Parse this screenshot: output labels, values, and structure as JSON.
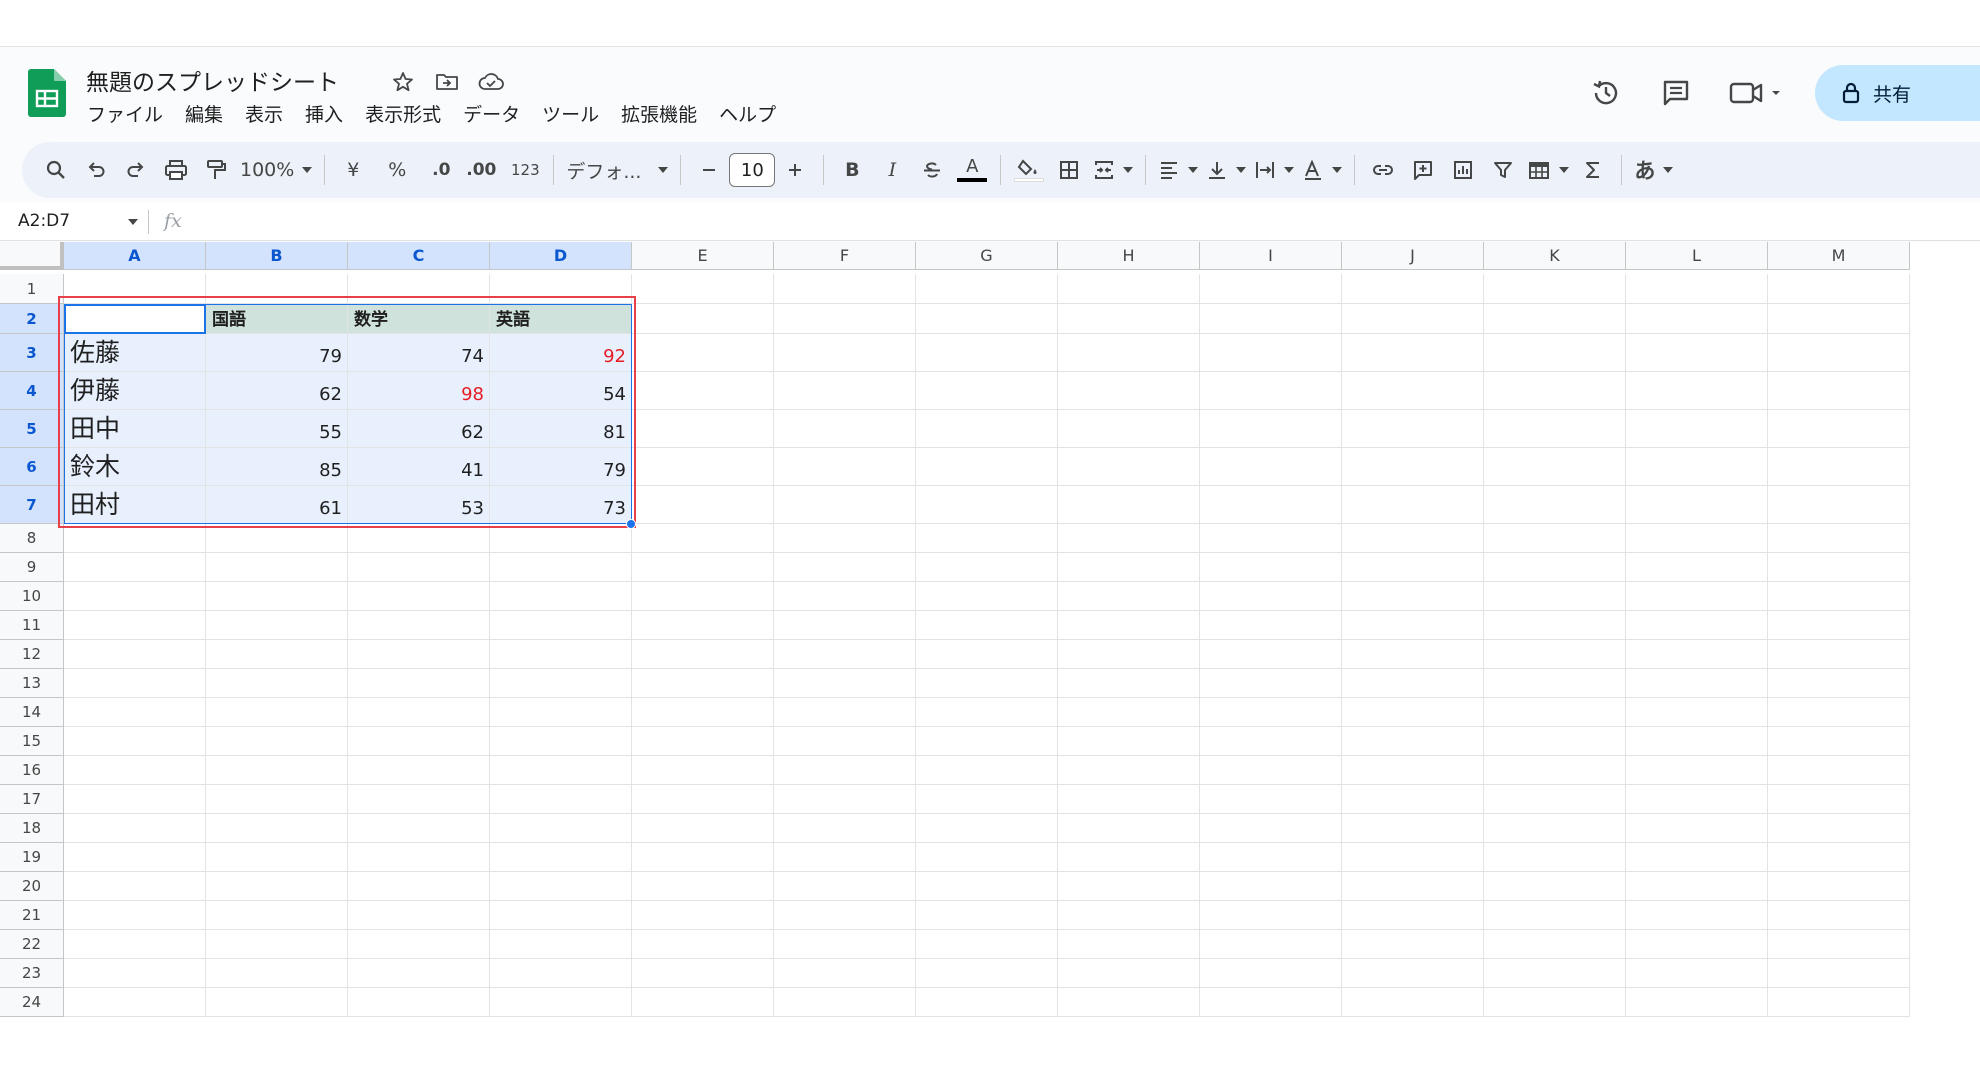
{
  "app": {
    "title": "無題のスプレッドシート",
    "menu": [
      "ファイル",
      "編集",
      "表示",
      "挿入",
      "表示形式",
      "データ",
      "ツール",
      "拡張機能",
      "ヘルプ"
    ],
    "share_label": "共有"
  },
  "toolbar": {
    "zoom": "100%",
    "currency": "¥",
    "percent": "%",
    "dec_decrease": ".0",
    "dec_increase": ".00",
    "number_format": "123",
    "font": "デフォ...",
    "font_size": "10",
    "bold": "B",
    "italic": "I",
    "text_color_glyph": "A",
    "ime_glyph": "あ"
  },
  "formula_bar": {
    "name_box": "A2:D7",
    "fx": "fx",
    "value": ""
  },
  "sheet": {
    "columns": [
      "A",
      "B",
      "C",
      "D",
      "E",
      "F",
      "G",
      "H",
      "I",
      "J",
      "K",
      "L",
      "M"
    ],
    "selected_columns": [
      "A",
      "B",
      "C",
      "D"
    ],
    "rows": [
      "1",
      "2",
      "3",
      "4",
      "5",
      "6",
      "7",
      "8",
      "9",
      "10",
      "11",
      "12",
      "13",
      "14",
      "15",
      "16",
      "17",
      "18",
      "19",
      "20",
      "21",
      "22",
      "23",
      "24"
    ],
    "selected_rows": [
      "2",
      "3",
      "4",
      "5",
      "6",
      "7"
    ],
    "header_row": [
      "",
      "国語",
      "数学",
      "英語"
    ],
    "data_rows": [
      {
        "name": "佐藤",
        "values": [
          "79",
          "74",
          "92"
        ],
        "red": [
          false,
          false,
          true
        ]
      },
      {
        "name": "伊藤",
        "values": [
          "62",
          "98",
          "54"
        ],
        "red": [
          false,
          true,
          false
        ]
      },
      {
        "name": "田中",
        "values": [
          "55",
          "62",
          "81"
        ],
        "red": [
          false,
          false,
          false
        ]
      },
      {
        "name": "鈴木",
        "values": [
          "85",
          "41",
          "79"
        ],
        "red": [
          false,
          false,
          false
        ]
      },
      {
        "name": "田村",
        "values": [
          "61",
          "53",
          "73"
        ],
        "red": [
          false,
          false,
          false
        ]
      }
    ],
    "colors": {
      "header_fill": "#cfe2dc",
      "selection_fill": "#e8f0fe",
      "highlight_red": "#e51c24",
      "annotation_box": "#e8404a"
    }
  }
}
